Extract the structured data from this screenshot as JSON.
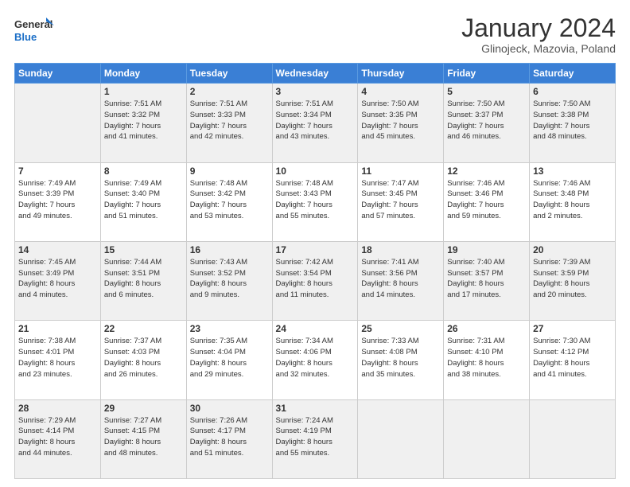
{
  "logo": {
    "line1": "General",
    "line2": "Blue"
  },
  "header": {
    "title": "January 2024",
    "subtitle": "Glinojeck, Mazovia, Poland"
  },
  "days_of_week": [
    "Sunday",
    "Monday",
    "Tuesday",
    "Wednesday",
    "Thursday",
    "Friday",
    "Saturday"
  ],
  "weeks": [
    [
      {
        "num": "",
        "info": ""
      },
      {
        "num": "1",
        "info": "Sunrise: 7:51 AM\nSunset: 3:32 PM\nDaylight: 7 hours\nand 41 minutes."
      },
      {
        "num": "2",
        "info": "Sunrise: 7:51 AM\nSunset: 3:33 PM\nDaylight: 7 hours\nand 42 minutes."
      },
      {
        "num": "3",
        "info": "Sunrise: 7:51 AM\nSunset: 3:34 PM\nDaylight: 7 hours\nand 43 minutes."
      },
      {
        "num": "4",
        "info": "Sunrise: 7:50 AM\nSunset: 3:35 PM\nDaylight: 7 hours\nand 45 minutes."
      },
      {
        "num": "5",
        "info": "Sunrise: 7:50 AM\nSunset: 3:37 PM\nDaylight: 7 hours\nand 46 minutes."
      },
      {
        "num": "6",
        "info": "Sunrise: 7:50 AM\nSunset: 3:38 PM\nDaylight: 7 hours\nand 48 minutes."
      }
    ],
    [
      {
        "num": "7",
        "info": "Sunrise: 7:49 AM\nSunset: 3:39 PM\nDaylight: 7 hours\nand 49 minutes."
      },
      {
        "num": "8",
        "info": "Sunrise: 7:49 AM\nSunset: 3:40 PM\nDaylight: 7 hours\nand 51 minutes."
      },
      {
        "num": "9",
        "info": "Sunrise: 7:48 AM\nSunset: 3:42 PM\nDaylight: 7 hours\nand 53 minutes."
      },
      {
        "num": "10",
        "info": "Sunrise: 7:48 AM\nSunset: 3:43 PM\nDaylight: 7 hours\nand 55 minutes."
      },
      {
        "num": "11",
        "info": "Sunrise: 7:47 AM\nSunset: 3:45 PM\nDaylight: 7 hours\nand 57 minutes."
      },
      {
        "num": "12",
        "info": "Sunrise: 7:46 AM\nSunset: 3:46 PM\nDaylight: 7 hours\nand 59 minutes."
      },
      {
        "num": "13",
        "info": "Sunrise: 7:46 AM\nSunset: 3:48 PM\nDaylight: 8 hours\nand 2 minutes."
      }
    ],
    [
      {
        "num": "14",
        "info": "Sunrise: 7:45 AM\nSunset: 3:49 PM\nDaylight: 8 hours\nand 4 minutes."
      },
      {
        "num": "15",
        "info": "Sunrise: 7:44 AM\nSunset: 3:51 PM\nDaylight: 8 hours\nand 6 minutes."
      },
      {
        "num": "16",
        "info": "Sunrise: 7:43 AM\nSunset: 3:52 PM\nDaylight: 8 hours\nand 9 minutes."
      },
      {
        "num": "17",
        "info": "Sunrise: 7:42 AM\nSunset: 3:54 PM\nDaylight: 8 hours\nand 11 minutes."
      },
      {
        "num": "18",
        "info": "Sunrise: 7:41 AM\nSunset: 3:56 PM\nDaylight: 8 hours\nand 14 minutes."
      },
      {
        "num": "19",
        "info": "Sunrise: 7:40 AM\nSunset: 3:57 PM\nDaylight: 8 hours\nand 17 minutes."
      },
      {
        "num": "20",
        "info": "Sunrise: 7:39 AM\nSunset: 3:59 PM\nDaylight: 8 hours\nand 20 minutes."
      }
    ],
    [
      {
        "num": "21",
        "info": "Sunrise: 7:38 AM\nSunset: 4:01 PM\nDaylight: 8 hours\nand 23 minutes."
      },
      {
        "num": "22",
        "info": "Sunrise: 7:37 AM\nSunset: 4:03 PM\nDaylight: 8 hours\nand 26 minutes."
      },
      {
        "num": "23",
        "info": "Sunrise: 7:35 AM\nSunset: 4:04 PM\nDaylight: 8 hours\nand 29 minutes."
      },
      {
        "num": "24",
        "info": "Sunrise: 7:34 AM\nSunset: 4:06 PM\nDaylight: 8 hours\nand 32 minutes."
      },
      {
        "num": "25",
        "info": "Sunrise: 7:33 AM\nSunset: 4:08 PM\nDaylight: 8 hours\nand 35 minutes."
      },
      {
        "num": "26",
        "info": "Sunrise: 7:31 AM\nSunset: 4:10 PM\nDaylight: 8 hours\nand 38 minutes."
      },
      {
        "num": "27",
        "info": "Sunrise: 7:30 AM\nSunset: 4:12 PM\nDaylight: 8 hours\nand 41 minutes."
      }
    ],
    [
      {
        "num": "28",
        "info": "Sunrise: 7:29 AM\nSunset: 4:14 PM\nDaylight: 8 hours\nand 44 minutes."
      },
      {
        "num": "29",
        "info": "Sunrise: 7:27 AM\nSunset: 4:15 PM\nDaylight: 8 hours\nand 48 minutes."
      },
      {
        "num": "30",
        "info": "Sunrise: 7:26 AM\nSunset: 4:17 PM\nDaylight: 8 hours\nand 51 minutes."
      },
      {
        "num": "31",
        "info": "Sunrise: 7:24 AM\nSunset: 4:19 PM\nDaylight: 8 hours\nand 55 minutes."
      },
      {
        "num": "",
        "info": ""
      },
      {
        "num": "",
        "info": ""
      },
      {
        "num": "",
        "info": ""
      }
    ]
  ]
}
